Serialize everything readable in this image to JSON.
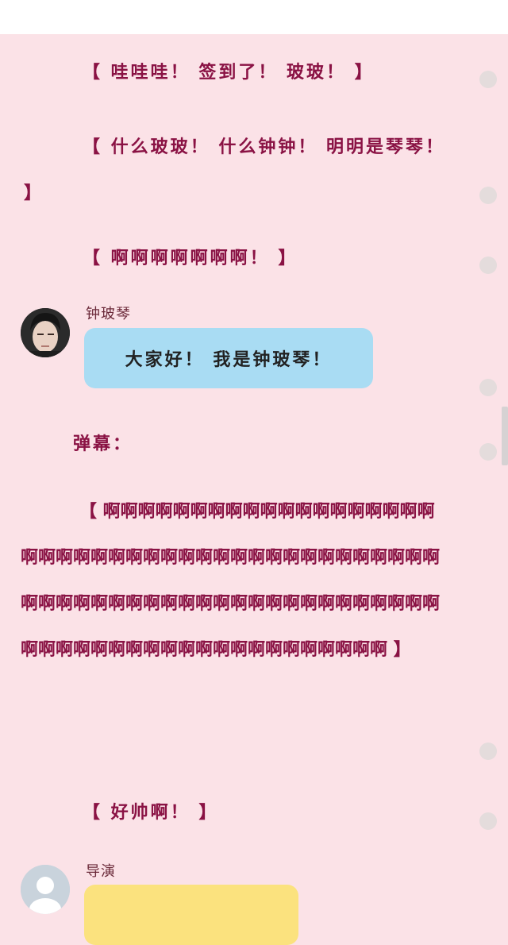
{
  "lines": {
    "line1": "【 哇哇哇！ 签到了！ 玻玻！ 】",
    "line2": "【 什么玻玻！ 什么钟钟！ 明明是琴琴！ 】",
    "line3": "【 啊啊啊啊啊啊啊！ 】",
    "danmu_label": "弹幕：",
    "danmu_text": "【 啊啊啊啊啊啊啊啊啊啊啊啊啊啊啊啊啊啊啊啊啊啊啊啊啊啊啊啊啊啊啊啊啊啊啊啊啊啊啊啊啊啊啊啊啊啊啊啊啊啊啊啊啊啊啊啊啊啊啊啊啊啊啊啊啊啊啊啊啊啊啊啊啊啊啊啊啊啊啊啊啊啊啊啊啊啊啊啊 】",
    "line4": "【 好帅啊！ 】"
  },
  "chat": [
    {
      "speaker": "钟玻琴",
      "message": "大家好！ 我是钟玻琴！"
    },
    {
      "speaker": "导演",
      "message": ""
    }
  ]
}
